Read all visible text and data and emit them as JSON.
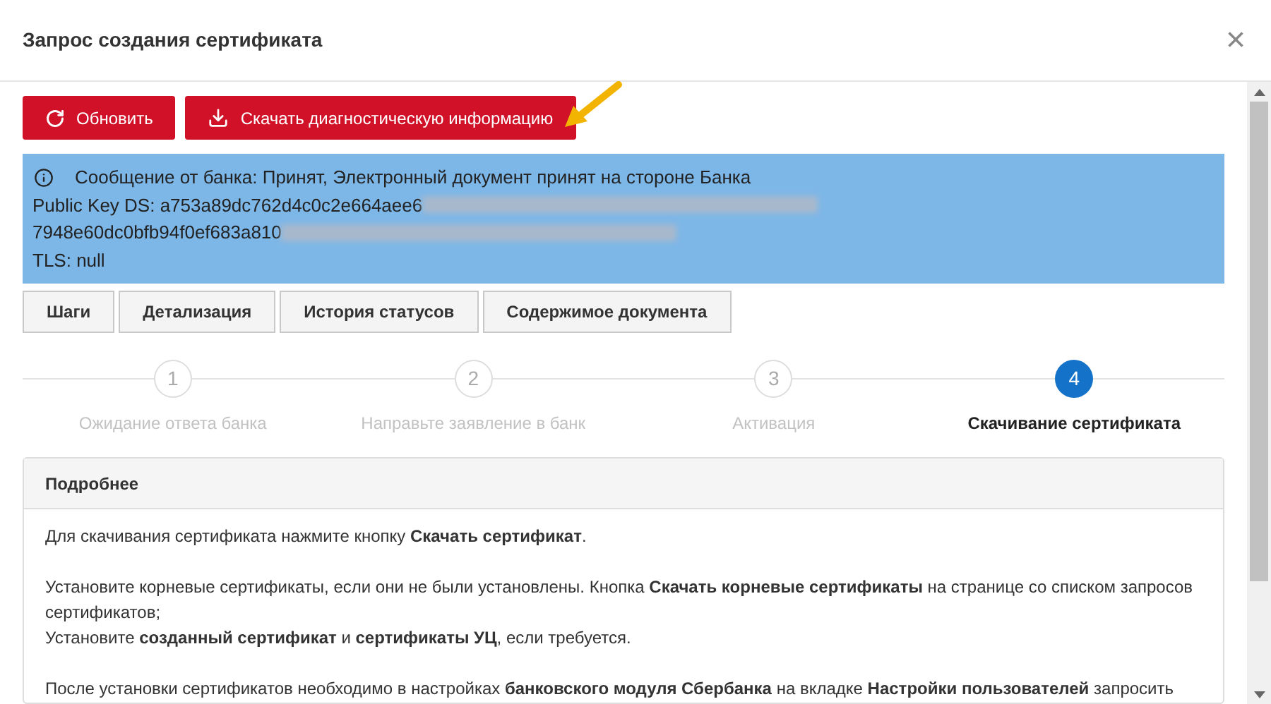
{
  "window": {
    "title": "Запрос создания сертификата",
    "close": "×"
  },
  "actions": [
    {
      "kind": "refresh",
      "label": "Обновить"
    },
    {
      "kind": "download",
      "label": "Скачать диагностическую информацию"
    }
  ],
  "message": {
    "lines": [
      {
        "text": "Сообщение от банка: Принят, Электронный документ принят на стороне Банка",
        "redacted": false
      },
      {
        "text": "Public Key DS: a753a89dc762d4c0c2e664aee6",
        "redacted": true
      },
      {
        "text": "7948e60dc0bfb94f0ef683a810",
        "redacted": true
      },
      {
        "text": "TLS: null",
        "redacted": false
      }
    ]
  },
  "tabs": [
    "Шаги",
    "Детализация",
    "История статусов",
    "Содержимое документа"
  ],
  "steps": [
    {
      "number": "1",
      "label": "Ожидание ответа банка",
      "selected": false
    },
    {
      "number": "2",
      "label": "Направьте заявление в банк",
      "selected": false
    },
    {
      "number": "3",
      "label": "Активация",
      "selected": false
    },
    {
      "number": "4",
      "label": "Скачивание сертификата",
      "selected": true
    }
  ],
  "details": {
    "title": "Подробнее",
    "paragraphs": [
      "Для скачивания сертификата нажмите кнопку **Скачать сертификат**.",
      "Установите корневые сертификаты, если они не были установлены. Кнопка **Скачать корневые сертификаты** на странице со списком запросов сертификатов;\nУстановите **созданный сертификат** и **сертификаты УЦ**, если требуется.",
      "После установки сертификатов необходимо в настройках **банковского модуля Сбербанка** на вкладке **Настройки пользователей** запросить"
    ]
  }
}
